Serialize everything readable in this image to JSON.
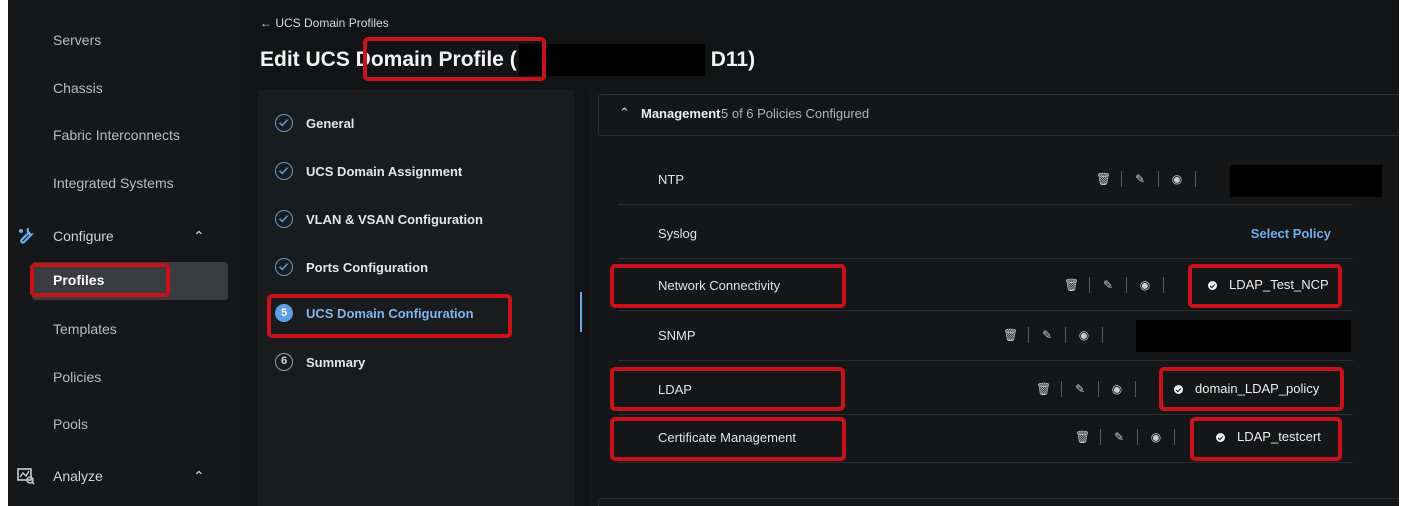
{
  "sidebar": {
    "items": [
      {
        "label": "Servers"
      },
      {
        "label": "Chassis"
      },
      {
        "label": "Fabric Interconnects"
      },
      {
        "label": "Integrated Systems"
      },
      {
        "label": "Configure"
      },
      {
        "label": "Profiles"
      },
      {
        "label": "Templates"
      },
      {
        "label": "Policies"
      },
      {
        "label": "Pools"
      },
      {
        "label": "Analyze"
      }
    ],
    "icons": {
      "configure": "configure-icon",
      "analyze": "analyze-icon",
      "chevron": "chevron-up-icon"
    }
  },
  "header": {
    "back_link": "← UCS Domain Profiles",
    "title_prefix": "Edit UCS ",
    "title_highlight": "Domain Profile",
    "title_open": " (",
    "title_suffix": "D11)"
  },
  "wizard": {
    "steps": [
      {
        "number": "",
        "label": "General",
        "state": "done"
      },
      {
        "number": "",
        "label": "UCS Domain Assignment",
        "state": "done"
      },
      {
        "number": "",
        "label": "VLAN & VSAN Configuration",
        "state": "done"
      },
      {
        "number": "",
        "label": "Ports Configuration",
        "state": "done"
      },
      {
        "number": "5",
        "label": "UCS Domain Configuration",
        "state": "active"
      },
      {
        "number": "6",
        "label": "Summary",
        "state": "todo"
      }
    ]
  },
  "management": {
    "title": "Management",
    "subtitle": "5 of 6 Policies Configured",
    "rows": [
      {
        "name": "NTP",
        "policy": ""
      },
      {
        "name": "Syslog",
        "action": "Select Policy"
      },
      {
        "name": "Network Connectivity",
        "policy": "LDAP_Test_NCP"
      },
      {
        "name": "SNMP",
        "policy": ""
      },
      {
        "name": "LDAP",
        "policy": "domain_LDAP_policy"
      },
      {
        "name": "Certificate Management",
        "policy": "LDAP_testcert"
      }
    ]
  },
  "colors": {
    "accent": "#5b9ee8",
    "highlight": "#c8131a",
    "link": "#6aaef0",
    "background": "#121314"
  }
}
